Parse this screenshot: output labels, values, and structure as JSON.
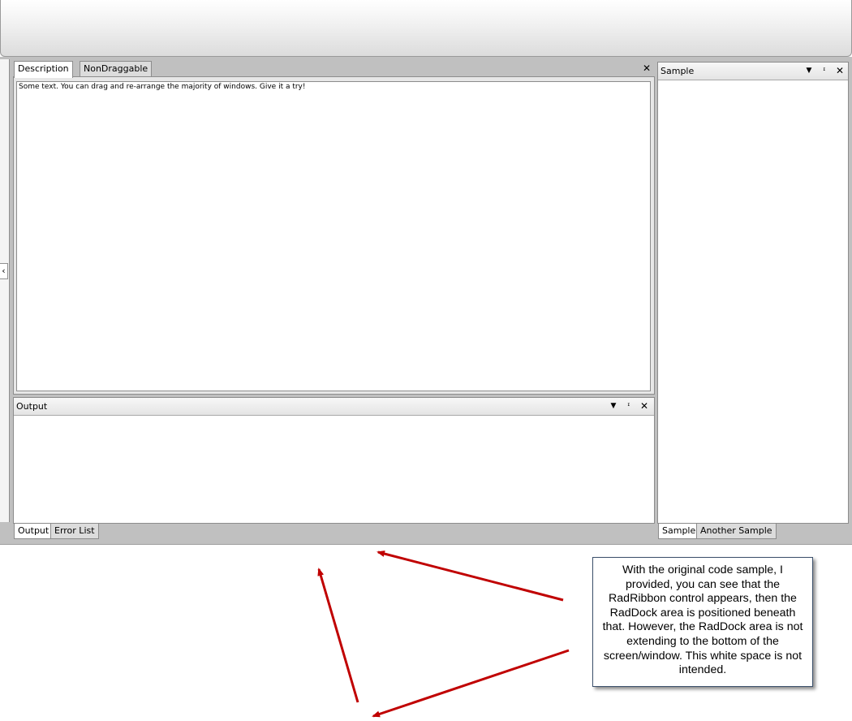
{
  "description_pane": {
    "tabs": [
      "Description",
      "NonDraggable"
    ],
    "text": "Some text.  You can drag and re-arrange the majority of windows.  Give it a try!",
    "close_icon": "close-icon"
  },
  "output_pane": {
    "title": "Output",
    "bottom_tabs": [
      "Output",
      "Error List"
    ],
    "icons": [
      "dropdown-icon",
      "pin-icon",
      "close-icon"
    ]
  },
  "sample_pane": {
    "title": "Sample",
    "bottom_tabs": [
      "Sample",
      "Another Sample"
    ],
    "icons": [
      "dropdown-icon",
      "pin-icon",
      "close-icon"
    ]
  },
  "left_edge": {
    "icon": "chevron-left-icon"
  },
  "annotation": {
    "text": "With the original code sample, I provided, you can see that the RadRibbon control appears, then the RadDock area is positioned beneath that.  However, the RadDock area is not extending to the bottom of the screen/window.  This white space is not intended.",
    "arrow_color": "#c00000"
  },
  "colors": {
    "dock_background": "#c0c0c0",
    "arrow": "#c00000",
    "callout_border": "#3b4f6b"
  }
}
